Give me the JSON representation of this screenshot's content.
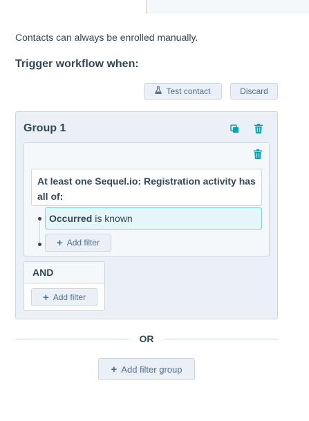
{
  "intro_text": "Contacts can always be enrolled manually.",
  "heading": "Trigger workflow when:",
  "toolbar": {
    "test_contact_label": "Test contact",
    "test_contact_icon": "flask-icon",
    "discard_label": "Discard"
  },
  "group": {
    "title": "Group 1",
    "copy_icon": "copy-icon",
    "delete_icon": "trash-icon",
    "filter": {
      "activity_text": "At least one Sequel.io: Registration activity has all of:",
      "condition_property": "Occurred",
      "condition_operator": "is known",
      "add_filter_label": "Add filter"
    },
    "and_block": {
      "label": "AND",
      "add_filter_label": "Add filter"
    }
  },
  "or_label": "OR",
  "add_filter_group_label": "Add filter group",
  "colors": {
    "text": "#33475b",
    "button_bg": "#eaf0f6",
    "button_text": "#506e91",
    "accent_icon": "#00a4bd",
    "border": "#cbd6e2",
    "condition_bg": "#e5f5f8",
    "condition_border": "#7fd1de"
  }
}
